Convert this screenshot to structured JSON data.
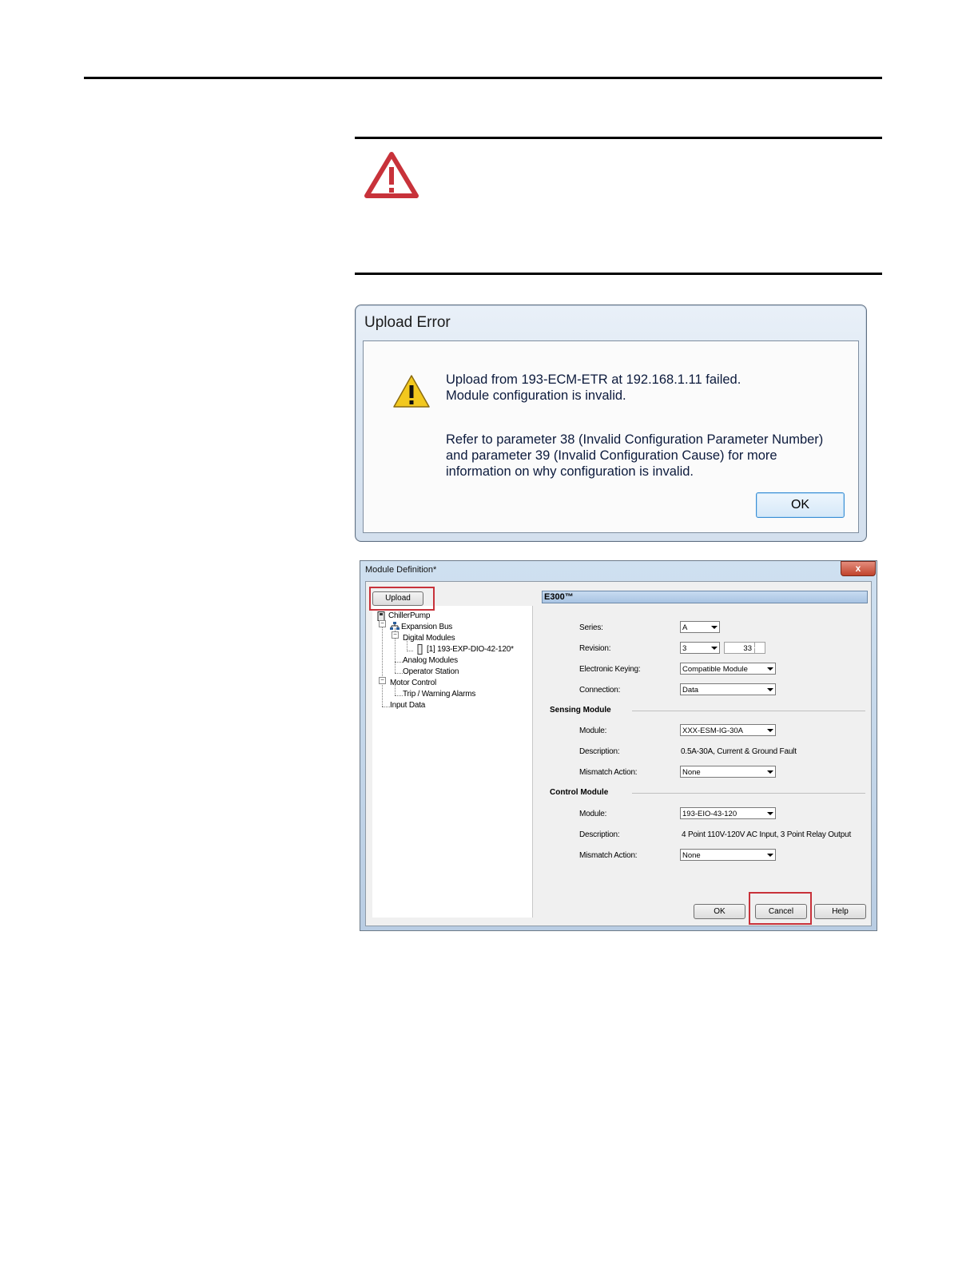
{
  "upload_error": {
    "title": "Upload Error",
    "line1": "Upload from 193-ECM-ETR at 192.168.1.11 failed.",
    "line2": "Module configuration is invalid.",
    "line3": "Refer to parameter 38 (Invalid Configuration Parameter Number)",
    "line4": "and parameter 39 (Invalid Configuration Cause) for more",
    "line5": "information on why configuration is invalid.",
    "ok_label": "OK"
  },
  "module_definition": {
    "title": "Module Definition*",
    "close_label": "x",
    "upload_label": "Upload",
    "tree": {
      "root": "ChillerPump",
      "expansion_bus": "Expansion Bus",
      "digital_modules": "Digital Modules",
      "digital_item": "[1] 193-EXP-DIO-42-120*",
      "analog_modules": "Analog Modules",
      "operator_station": "Operator Station",
      "motor_control": "Motor Control",
      "trip_warning": "Trip / Warning Alarms",
      "input_data": "Input Data"
    },
    "header": "E300™",
    "series_label": "Series:",
    "series_value": "A",
    "revision_label": "Revision:",
    "revision_major": "3",
    "revision_minor": "33",
    "keying_label": "Electronic Keying:",
    "keying_value": "Compatible Module",
    "connection_label": "Connection:",
    "connection_value": "Data",
    "sensing": {
      "title": "Sensing Module",
      "module_label": "Module:",
      "module_value": "XXX-ESM-IG-30A",
      "description_label": "Description:",
      "description_value": "0.5A-30A, Current & Ground Fault",
      "mismatch_label": "Mismatch Action:",
      "mismatch_value": "None"
    },
    "control": {
      "title": "Control Module",
      "module_label": "Module:",
      "module_value": "193-EIO-43-120",
      "description_label": "Description:",
      "description_value": "4 Point 110V-120V AC Input, 3 Point Relay Output",
      "mismatch_label": "Mismatch Action:",
      "mismatch_value": "None"
    },
    "ok_label": "OK",
    "cancel_label": "Cancel",
    "help_label": "Help"
  },
  "colors": {
    "warning_red": "#c8323a",
    "highlight_red": "#c8323a",
    "caution_yellow": "#f2c81e"
  },
  "icons": [
    "warning-triangle-icon",
    "caution-icon",
    "close-icon",
    "dropdown-arrow-icon"
  ]
}
